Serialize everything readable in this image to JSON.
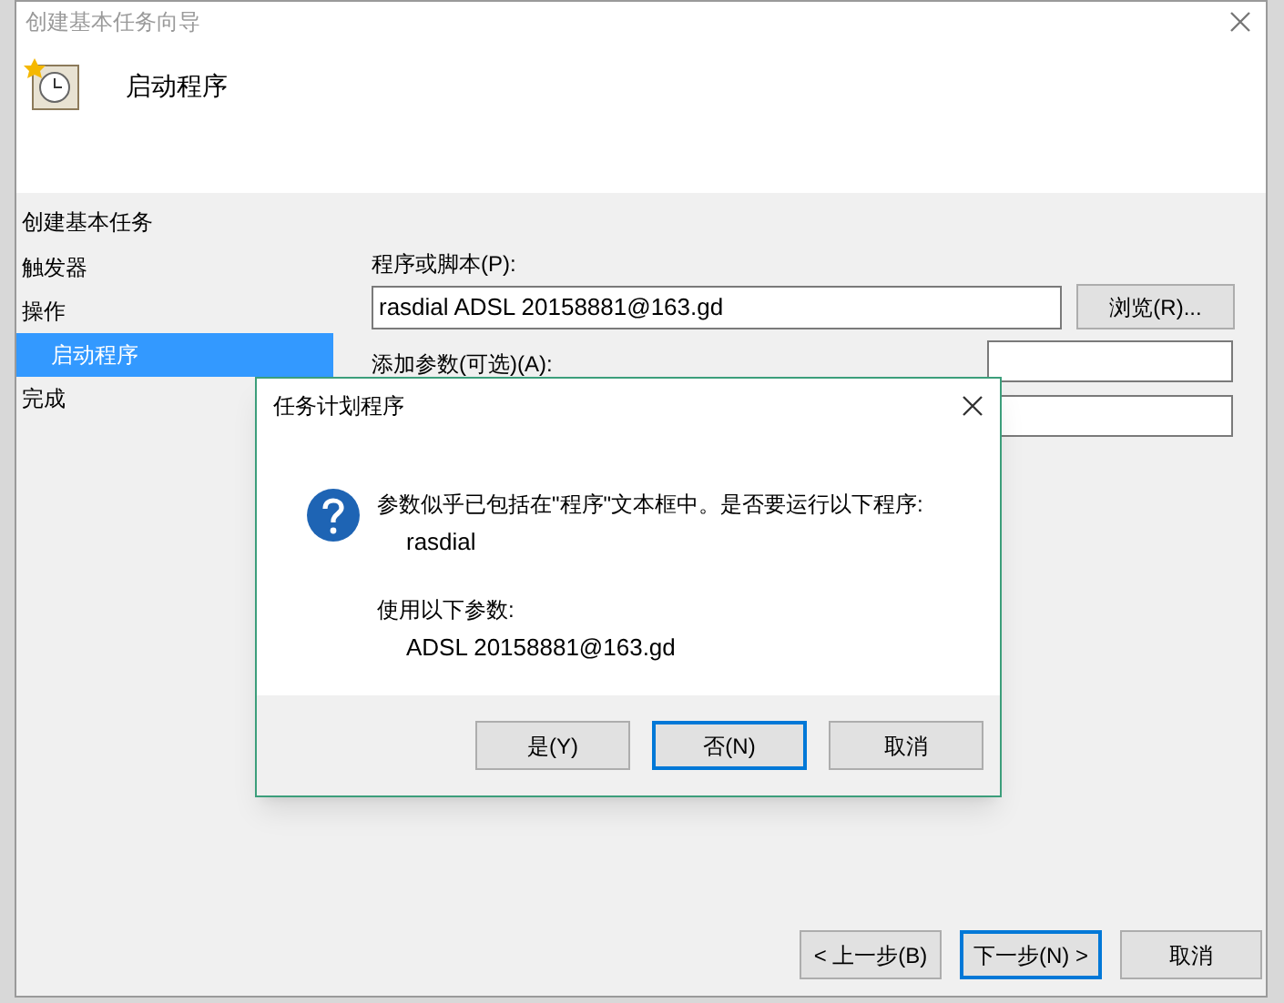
{
  "window": {
    "title": "创建基本任务向导",
    "heading": "启动程序"
  },
  "sidebar": {
    "title": "创建基本任务",
    "items": [
      {
        "label": "触发器",
        "selected": false
      },
      {
        "label": "操作",
        "selected": false,
        "children": [
          {
            "label": "启动程序",
            "selected": true
          }
        ]
      },
      {
        "label": "完成",
        "selected": false
      }
    ]
  },
  "form": {
    "program_label": "程序或脚本(P):",
    "program_value": "rasdial ADSL 20158881@163.gd",
    "browse_button": "浏览(R)...",
    "args_label": "添加参数(可选)(A):"
  },
  "footer_buttons": [
    {
      "label": "< 上一步(B)",
      "default": false
    },
    {
      "label": "下一步(N) >",
      "default": true
    },
    {
      "label": "取消",
      "default": false
    }
  ],
  "dialog": {
    "title": "任务计划程序",
    "message": "参数似乎已包括在\"程序\"文本框中。是否要运行以下程序:",
    "program": "rasdial",
    "args_label": "使用以下参数:",
    "args": "ADSL 20158881@163.gd",
    "buttons": [
      {
        "label": "是(Y)",
        "default": false
      },
      {
        "label": "否(N)",
        "default": true
      },
      {
        "label": "取消",
        "default": false
      }
    ]
  }
}
